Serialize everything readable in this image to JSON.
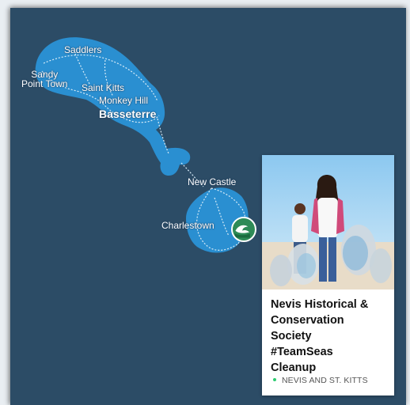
{
  "map": {
    "places": {
      "saddlers": "Saddlers",
      "sandy_point_line1": "Sandy",
      "sandy_point_line2": "Point Town",
      "saint_kitts": "Saint Kitts",
      "monkey_hill": "Monkey Hill",
      "basseterre": "Basseterre",
      "new_castle": "New Castle",
      "charlestown": "Charlestown"
    },
    "colors": {
      "sea": "#2c4c66",
      "land": "#2a8fd1",
      "road": "#d8ecf8",
      "marker": "#2e8b57"
    },
    "marker_icon": "wave-logo-icon"
  },
  "card": {
    "title_lines": [
      "Nevis Historical &",
      "Conservation",
      "Society",
      "#TeamSeas",
      "Cleanup"
    ],
    "location": "NEVIS AND ST. KITTS",
    "location_dot_color": "#2ecc71",
    "photo_icon": "cleanup-volunteers-photo"
  }
}
